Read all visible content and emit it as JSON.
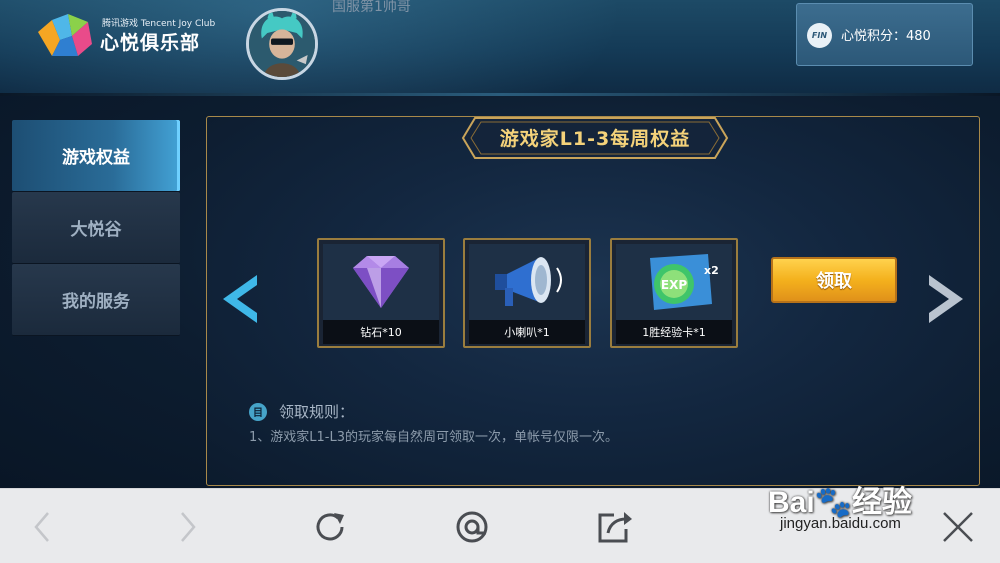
{
  "header": {
    "logo_small": "腾讯游戏 Tencent Joy Club",
    "logo_big": "心悦俱乐部",
    "username": "国服第1帅哥",
    "points_icon": "FIN",
    "points_text": "心悦积分：480"
  },
  "sidebar": {
    "items": [
      {
        "label": "游戏权益",
        "active": true
      },
      {
        "label": "大悦谷",
        "active": false
      },
      {
        "label": "我的服务",
        "active": false
      }
    ]
  },
  "panel": {
    "title": "游戏家L1-3每周权益",
    "rewards": [
      {
        "label": "钻石*10",
        "icon": "diamond-icon"
      },
      {
        "label": "小喇叭*1",
        "icon": "megaphone-icon"
      },
      {
        "label": "1胜经验卡*1",
        "icon": "exp-card-icon"
      }
    ],
    "claim_label": "领取",
    "rules_title": "领取规则：",
    "rules_text": "1、游戏家L1-L3的玩家每自然周可领取一次，单帐号仅限一次。"
  },
  "watermark": {
    "main": "Bai🐾经验",
    "sub": "jingyan.baidu.com"
  },
  "colors": {
    "accent_gold": "#f4d27a",
    "claim_button": "#f4b11d",
    "sidebar_active": "#2a6c98"
  }
}
